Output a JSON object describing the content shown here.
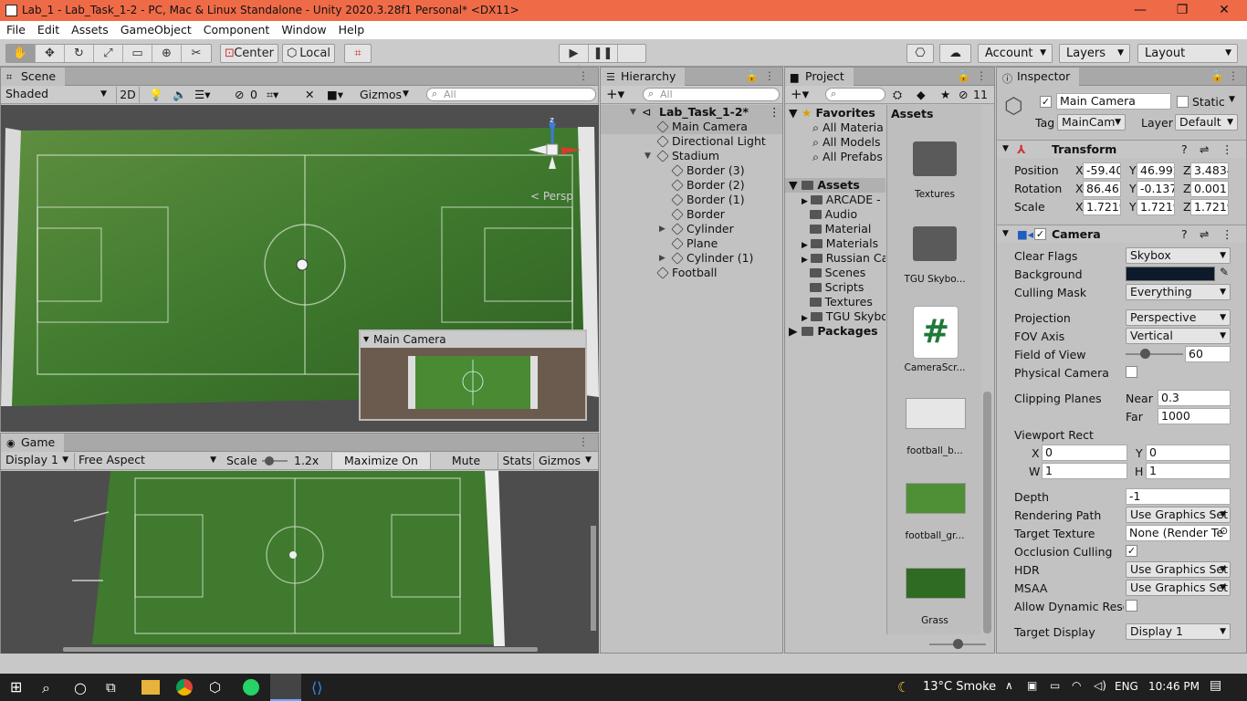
{
  "titlebar": {
    "title": "Lab_1 - Lab_Task_1-2 - PC, Mac & Linux Standalone - Unity 2020.3.28f1 Personal* <DX11>",
    "minimize": "—",
    "maximize": "❐",
    "close": "✕"
  },
  "menu": [
    "File",
    "Edit",
    "Assets",
    "GameObject",
    "Component",
    "Window",
    "Help"
  ],
  "toolbar": {
    "center_label": "Center",
    "local_label": "Local",
    "account_label": "Account",
    "layers_label": "Layers",
    "layout_label": "Layout",
    "accent": "#ef6b48"
  },
  "scene": {
    "tab": "Scene",
    "shading": "Shaded",
    "mode_2d": "2D",
    "hidden_count": "0",
    "gizmos": "Gizmos",
    "search_placeholder": "All",
    "persp": "< Persp",
    "axis_z": "z",
    "preview_title": "Main Camera"
  },
  "game": {
    "tab": "Game",
    "display": "Display 1",
    "aspect": "Free Aspect",
    "scale_label": "Scale",
    "scale_value": "1.2x",
    "maximize": "Maximize On Play",
    "mute": "Mute Audio",
    "stats": "Stats",
    "gizmos": "Gizmos"
  },
  "hierarchy": {
    "tab": "Hierarchy",
    "search_placeholder": "All",
    "scene_name": "Lab_Task_1-2*",
    "items": [
      {
        "label": "Main Camera",
        "depth": 1,
        "selected": true,
        "arrow": false
      },
      {
        "label": "Directional Light",
        "depth": 1,
        "selected": false,
        "arrow": false
      },
      {
        "label": "Stadium",
        "depth": 1,
        "selected": false,
        "arrow": "open"
      },
      {
        "label": "Border (3)",
        "depth": 2,
        "selected": false,
        "arrow": false
      },
      {
        "label": "Border (2)",
        "depth": 2,
        "selected": false,
        "arrow": false
      },
      {
        "label": "Border (1)",
        "depth": 2,
        "selected": false,
        "arrow": false
      },
      {
        "label": "Border",
        "depth": 2,
        "selected": false,
        "arrow": false
      },
      {
        "label": "Cylinder",
        "depth": 2,
        "selected": false,
        "arrow": "closed"
      },
      {
        "label": "Plane",
        "depth": 2,
        "selected": false,
        "arrow": false
      },
      {
        "label": "Cylinder (1)",
        "depth": 2,
        "selected": false,
        "arrow": "closed"
      },
      {
        "label": "Football",
        "depth": 1,
        "selected": false,
        "arrow": false
      }
    ]
  },
  "project": {
    "tab": "Project",
    "count": "11",
    "favorites_label": "Favorites",
    "favorites": [
      "All Materia",
      "All Models",
      "All Prefabs"
    ],
    "assets_label": "Assets",
    "asset_folders": [
      {
        "label": "ARCADE -",
        "arrow": true
      },
      {
        "label": "Audio",
        "arrow": false
      },
      {
        "label": "Material",
        "arrow": false
      },
      {
        "label": "Materials",
        "arrow": true
      },
      {
        "label": "Russian Ca",
        "arrow": true
      },
      {
        "label": "Scenes",
        "arrow": false
      },
      {
        "label": "Scripts",
        "arrow": false
      },
      {
        "label": "Textures",
        "arrow": false
      },
      {
        "label": "TGU Skybo",
        "arrow": true
      }
    ],
    "packages_label": "Packages",
    "grid_header": "Assets",
    "grid": [
      {
        "label": "Textures",
        "kind": "folder"
      },
      {
        "label": "TGU Skybo...",
        "kind": "folder"
      },
      {
        "label": "CameraScr...",
        "kind": "script",
        "glyph": "#"
      },
      {
        "label": "football_b...",
        "kind": "image-ball"
      },
      {
        "label": "football_gr...",
        "kind": "image-field"
      },
      {
        "label": "Grass",
        "kind": "image-grass"
      }
    ]
  },
  "inspector": {
    "tab": "Inspector",
    "object_name": "Main Camera",
    "static_label": "Static",
    "tag_label": "Tag",
    "tag_value": "MainCam",
    "layer_label": "Layer",
    "layer_value": "Default",
    "transform": {
      "title": "Transform",
      "rows": [
        {
          "label": "Position",
          "x": "-59.40",
          "y": "46.992",
          "z": "3.4834"
        },
        {
          "label": "Rotation",
          "x": "86.46",
          "y": "-0.137",
          "z": "0.001"
        },
        {
          "label": "Scale",
          "x": "1.7219",
          "y": "1.7219",
          "z": "1.7219"
        }
      ]
    },
    "camera": {
      "title": "Camera",
      "clear_flags_label": "Clear Flags",
      "clear_flags": "Skybox",
      "background_label": "Background",
      "background_color": "#0c1a2c",
      "culling_mask_label": "Culling Mask",
      "culling_mask": "Everything",
      "projection_label": "Projection",
      "projection": "Perspective",
      "fov_axis_label": "FOV Axis",
      "fov_axis": "Vertical",
      "fov_label": "Field of View",
      "fov": "60",
      "physical_label": "Physical Camera",
      "clipping_label": "Clipping Planes",
      "near_label": "Near",
      "near": "0.3",
      "far_label": "Far",
      "far": "1000",
      "viewport_label": "Viewport Rect",
      "vx_label": "X",
      "vx": "0",
      "vy_label": "Y",
      "vy": "0",
      "vw_label": "W",
      "vw": "1",
      "vh_label": "H",
      "vh": "1",
      "depth_label": "Depth",
      "depth": "-1",
      "render_path_label": "Rendering Path",
      "render_path": "Use Graphics Set",
      "target_texture_label": "Target Texture",
      "target_texture": "None (Render Te",
      "occlusion_label": "Occlusion Culling",
      "hdr_label": "HDR",
      "hdr": "Use Graphics Set",
      "msaa_label": "MSAA",
      "msaa": "Use Graphics Set",
      "dynamic_label": "Allow Dynamic Resol",
      "target_display_label": "Target Display",
      "target_display": "Display 1"
    }
  },
  "taskbar": {
    "weather": "13°C  Smoke",
    "lang": "ENG",
    "time": "10:46 PM"
  }
}
